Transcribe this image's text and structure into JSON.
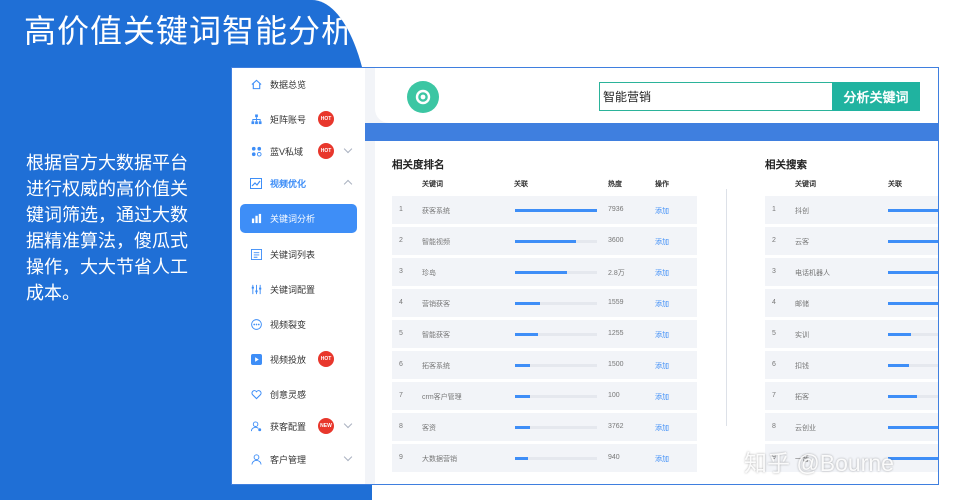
{
  "promo": {
    "title": "高价值关键词智能分析",
    "description": "根据官方大数据平台进行权威的高价值关键词筛选，通过大数据精准算法，傻瓜式操作，大大节省人工成本。"
  },
  "sidebar": {
    "items": [
      {
        "label": "数据总览",
        "icon": "home-icon"
      },
      {
        "label": "矩阵账号",
        "icon": "org-chart-icon",
        "badge": "HOT"
      },
      {
        "label": "蓝V私域",
        "icon": "grid-icon",
        "badge": "HOT"
      },
      {
        "label": "视频优化",
        "icon": "trend-icon"
      },
      {
        "label": "关键词分析",
        "icon": "bar-chart-icon"
      },
      {
        "label": "关键词列表",
        "icon": "list-icon"
      },
      {
        "label": "关键词配置",
        "icon": "sliders-icon"
      },
      {
        "label": "视频裂变",
        "icon": "dots-icon"
      },
      {
        "label": "视频投放",
        "icon": "play-icon",
        "badge": "HOT"
      },
      {
        "label": "创意灵感",
        "icon": "heart-icon"
      },
      {
        "label": "获客配置",
        "icon": "user-gear-icon",
        "badge": "NEW"
      },
      {
        "label": "客户管理",
        "icon": "user-icon"
      }
    ]
  },
  "search": {
    "value": "智能营销",
    "button": "分析关键词"
  },
  "relevance": {
    "title": "相关度排名",
    "headers": [
      "关键词",
      "关联",
      "热度",
      "操作"
    ],
    "rows": [
      {
        "rank": "1",
        "keyword": "获客系统",
        "relevance": 1.0,
        "heat": "7936",
        "action": "添加"
      },
      {
        "rank": "2",
        "keyword": "智能视频",
        "relevance": 0.74,
        "heat": "3600",
        "action": "添加"
      },
      {
        "rank": "3",
        "keyword": "珍岛",
        "relevance": 0.64,
        "heat": "2.8万",
        "action": "添加"
      },
      {
        "rank": "4",
        "keyword": "营销获客",
        "relevance": 0.3,
        "heat": "1559",
        "action": "添加"
      },
      {
        "rank": "5",
        "keyword": "智能获客",
        "relevance": 0.28,
        "heat": "1255",
        "action": "添加"
      },
      {
        "rank": "6",
        "keyword": "拓客系统",
        "relevance": 0.18,
        "heat": "1500",
        "action": "添加"
      },
      {
        "rank": "7",
        "keyword": "crm客户管理",
        "relevance": 0.18,
        "heat": "100",
        "action": "添加"
      },
      {
        "rank": "8",
        "keyword": "客资",
        "relevance": 0.18,
        "heat": "3762",
        "action": "添加"
      },
      {
        "rank": "9",
        "keyword": "大数据营销",
        "relevance": 0.16,
        "heat": "940",
        "action": "添加"
      }
    ]
  },
  "related": {
    "title": "相关搜索",
    "headers": [
      "关键词",
      "关联"
    ],
    "rows": [
      {
        "rank": "1",
        "keyword": "抖创",
        "relevance": 1.0
      },
      {
        "rank": "2",
        "keyword": "云客",
        "relevance": 1.0
      },
      {
        "rank": "3",
        "keyword": "电话机器人",
        "relevance": 1.0
      },
      {
        "rank": "4",
        "keyword": "邮储",
        "relevance": 1.0
      },
      {
        "rank": "5",
        "keyword": "实训",
        "relevance": 0.45
      },
      {
        "rank": "6",
        "keyword": "扣钱",
        "relevance": 0.4
      },
      {
        "rank": "7",
        "keyword": "拓客",
        "relevance": 0.55
      },
      {
        "rank": "8",
        "keyword": "云创业",
        "relevance": 1.0
      },
      {
        "rank": "9",
        "keyword": "一音",
        "relevance": 1.0
      }
    ]
  },
  "watermark": "知乎 @Bourne",
  "colors": {
    "primary": "#1f6fd6",
    "accent": "#3e8ef7",
    "teal": "#20b3a0",
    "hot": "#e8372c"
  }
}
